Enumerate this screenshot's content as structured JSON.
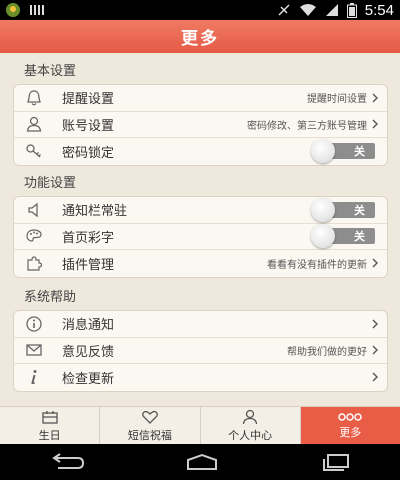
{
  "status_bar": {
    "time": "5:54"
  },
  "header": {
    "title": "更多"
  },
  "sections": [
    {
      "title": "基本设置",
      "items": [
        {
          "icon": "bell-icon",
          "label": "提醒设置",
          "detail": "提醒时间设置",
          "control": "chevron"
        },
        {
          "icon": "user-icon",
          "label": "账号设置",
          "detail": "密码修改、第三方账号管理",
          "control": "chevron"
        },
        {
          "icon": "key-icon",
          "label": "密码锁定",
          "detail": "",
          "control": "toggle",
          "toggle_text": "关"
        }
      ]
    },
    {
      "title": "功能设置",
      "items": [
        {
          "icon": "speaker-icon",
          "label": "通知栏常驻",
          "detail": "",
          "control": "toggle",
          "toggle_text": "关"
        },
        {
          "icon": "palette-icon",
          "label": "首页彩字",
          "detail": "",
          "control": "toggle",
          "toggle_text": "关"
        },
        {
          "icon": "puzzle-icon",
          "label": "插件管理",
          "detail": "看看有没有插件的更新",
          "control": "chevron"
        }
      ]
    },
    {
      "title": "系统帮助",
      "items": [
        {
          "icon": "info-icon",
          "label": "消息通知",
          "detail": "",
          "control": "chevron"
        },
        {
          "icon": "mail-icon",
          "label": "意见反馈",
          "detail": "帮助我们做的更好",
          "control": "chevron"
        },
        {
          "icon": "info-italic-icon",
          "label": "检查更新",
          "detail": "",
          "control": "chevron"
        }
      ]
    }
  ],
  "tabs": [
    {
      "label": "生日",
      "icon": "calendar-icon",
      "active": false
    },
    {
      "label": "短信祝福",
      "icon": "heart-icon",
      "active": false
    },
    {
      "label": "个人中心",
      "icon": "person-icon",
      "active": false
    },
    {
      "label": "更多",
      "icon": "more-dots-icon",
      "active": true
    }
  ],
  "colors": {
    "accent": "#e95c46",
    "background": "#efe8dc"
  }
}
